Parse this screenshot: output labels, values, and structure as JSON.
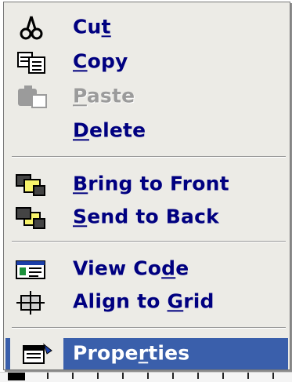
{
  "menu": {
    "items": [
      {
        "id": "cut",
        "pre": "Cu",
        "u": "t",
        "post": "",
        "icon": "scissors-icon",
        "enabled": true
      },
      {
        "id": "copy",
        "pre": "",
        "u": "C",
        "post": "opy",
        "icon": "copy-icon",
        "enabled": true
      },
      {
        "id": "paste",
        "pre": "",
        "u": "P",
        "post": "aste",
        "icon": "paste-icon",
        "enabled": false
      },
      {
        "id": "delete",
        "pre": "",
        "u": "D",
        "post": "elete",
        "icon": "",
        "enabled": true
      },
      {
        "id": "bring-to-front",
        "pre": "",
        "u": "B",
        "post": "ring to Front",
        "icon": "bring-to-front-icon",
        "enabled": true
      },
      {
        "id": "send-to-back",
        "pre": "",
        "u": "S",
        "post": "end to Back",
        "icon": "send-to-back-icon",
        "enabled": true
      },
      {
        "id": "view-code",
        "pre": "View Co",
        "u": "d",
        "post": "e",
        "icon": "view-code-icon",
        "enabled": true
      },
      {
        "id": "align-to-grid",
        "pre": "Align to ",
        "u": "G",
        "post": "rid",
        "icon": "align-to-grid-icon",
        "enabled": true
      },
      {
        "id": "properties",
        "pre": "Prope",
        "u": "r",
        "post": "ties",
        "icon": "properties-icon",
        "enabled": true,
        "selected": true
      }
    ]
  },
  "colors": {
    "menu_bg": "#ecebe6",
    "label": "#000080",
    "disabled": "#9b9b9b",
    "highlight": "#3a5fab"
  }
}
